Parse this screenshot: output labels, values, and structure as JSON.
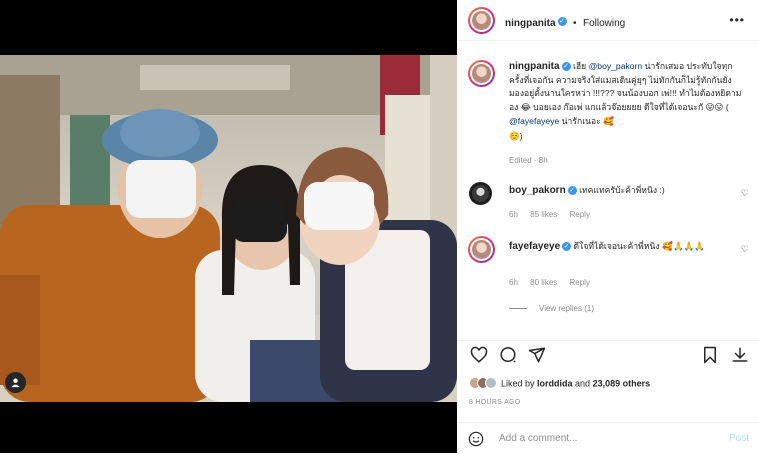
{
  "header": {
    "username": "ningpanita",
    "separator": "•",
    "follow_status": "Following",
    "more_icon": "more-horizontal-icon"
  },
  "caption": {
    "username": "ningpanita",
    "text_1": "เฮีย ",
    "mention_1": "@boy_pakorn",
    "text_2": " น่ารักเสมอ ประทับใจทุกครั้งที่เจอกัน ความจริงใส่แมสเดินคู่ยุๆ ไม่ทักกันก็ไม่รู้ทักกันยังมองอยู่ตั้งนานใครหว่า !!!??? จนน้องบอก เพ่!!! ทำไมต้องหยิดามอง ",
    "emoji_1": "😂",
    "text_3": " บอยเอง ก๊อเพ่ แกแล้วจ๊อยยยย ดีใจที่ได้เจอนะกั ",
    "emoji_2": "😛😛",
    "text_4": " ( ",
    "mention_2": "@fayefayeye",
    "text_5": " น่ารักเนอะ ",
    "emoji_3": "🥰",
    "emoji_4": "☺️",
    "text_6": ")",
    "meta": "Edited · 8h"
  },
  "comments": [
    {
      "username": "boy_pakorn",
      "text": "เทคแทครับ้ะค้าพี่หนิง :)",
      "time": "6h",
      "likes": "85 likes",
      "reply": "Reply"
    },
    {
      "username": "fayefayeye",
      "text": "ดีใจที่ได้เจอนะค้าพี่หนิง 🥰🙏🙏🙏",
      "time": "6h",
      "likes": "80 likes",
      "reply": "Reply"
    }
  ],
  "view_replies": "View replies (1)",
  "actions": {
    "icons": [
      "heart-icon",
      "comment-icon",
      "share-icon",
      "bookmark-icon",
      "download-icon"
    ]
  },
  "likes": {
    "prefix": "Liked by ",
    "user": "lorddida",
    "middle": " and ",
    "count": "23,089 others"
  },
  "posted_ago": "8 HOURS AGO",
  "add_comment": {
    "placeholder": "Add a comment...",
    "post_label": "Post"
  },
  "colors": {
    "verified": "#3897f0",
    "mention": "#00376b",
    "post_disabled": "#b2dffc",
    "muted": "#8e8e8e"
  }
}
